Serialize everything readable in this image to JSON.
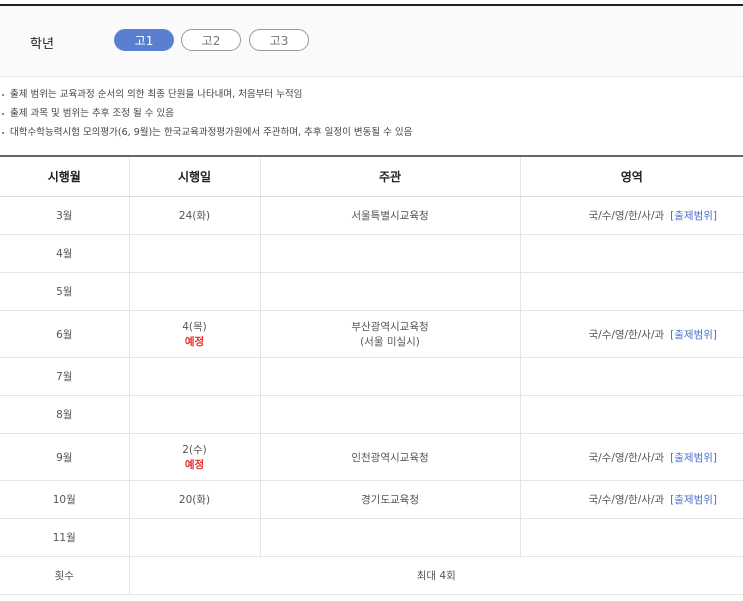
{
  "grade": {
    "label": "학년",
    "options": [
      "고1",
      "고2",
      "고3"
    ],
    "selected": "고1"
  },
  "notes": [
    "출제 범위는 교육과정 순서의 의한 최종 단원을 나타내며, 처음부터 누적임",
    "출제 과목 및 범위는 추후 조정 될 수 있음",
    "대학수학능력시험 모의평가(6, 9월)는 한국교육과정평가원에서 주관하며, 추후 일정이 변동될 수 있음"
  ],
  "table": {
    "headers": [
      "시행월",
      "시행일",
      "주관",
      "영역"
    ],
    "rows": [
      {
        "month": "3월",
        "date": "24(화)",
        "status": "",
        "org": "서울특별시교육청",
        "org2": "",
        "area": "국/수/영/한/사/과",
        "link": "[출제범위]"
      },
      {
        "month": "4월",
        "date": "",
        "status": "",
        "org": "",
        "org2": "",
        "area": "",
        "link": ""
      },
      {
        "month": "5월",
        "date": "",
        "status": "",
        "org": "",
        "org2": "",
        "area": "",
        "link": ""
      },
      {
        "month": "6월",
        "date": "4(목)",
        "status": "예정",
        "org": "부산광역시교육청",
        "org2": "(서울 미실시)",
        "area": "국/수/영/한/사/과",
        "link": "[출제범위]"
      },
      {
        "month": "7월",
        "date": "",
        "status": "",
        "org": "",
        "org2": "",
        "area": "",
        "link": ""
      },
      {
        "month": "8월",
        "date": "",
        "status": "",
        "org": "",
        "org2": "",
        "area": "",
        "link": ""
      },
      {
        "month": "9월",
        "date": "2(수)",
        "status": "예정",
        "org": "인천광역시교육청",
        "org2": "",
        "area": "국/수/영/한/사/과",
        "link": "[출제범위]"
      },
      {
        "month": "10월",
        "date": "20(화)",
        "status": "",
        "org": "경기도교육청",
        "org2": "",
        "area": "국/수/영/한/사/과",
        "link": "[출제범위]"
      },
      {
        "month": "11월",
        "date": "",
        "status": "",
        "org": "",
        "org2": "",
        "area": "",
        "link": ""
      }
    ],
    "total": {
      "label": "횟수",
      "value": "최대 4회"
    }
  }
}
